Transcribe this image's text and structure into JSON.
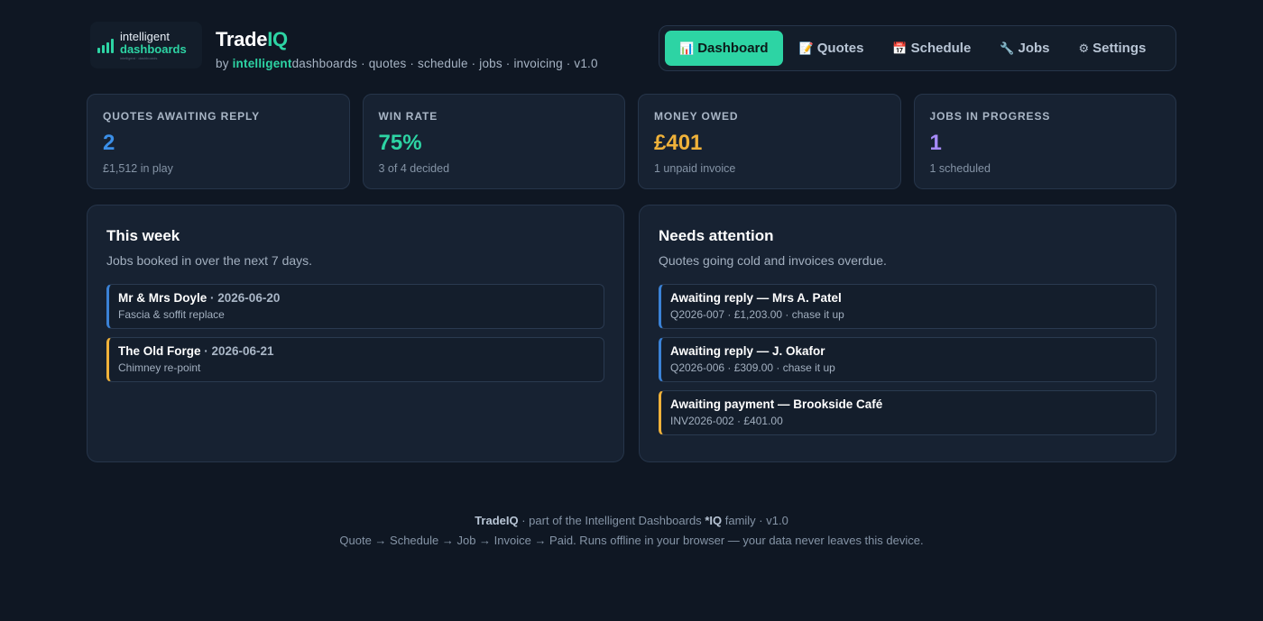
{
  "logo": {
    "line1": "intelligent",
    "line2": "dashboards",
    "tagline": "intelligent · dashboards"
  },
  "brand": {
    "title_main": "Trade",
    "title_accent": "IQ",
    "sub_prefix": "by ",
    "sub_em": "intelligent",
    "sub_rest": "dashboards · quotes · schedule · jobs · invoicing · v1.0"
  },
  "nav": [
    {
      "icon": "📊",
      "label": "Dashboard",
      "active": true
    },
    {
      "icon": "📝",
      "label": "Quotes"
    },
    {
      "icon": "📅",
      "label": "Schedule"
    },
    {
      "icon": "🔧",
      "label": "Jobs"
    },
    {
      "icon": "⚙",
      "label": "Settings"
    }
  ],
  "stats": [
    {
      "label": "QUOTES AWAITING REPLY",
      "value": "2",
      "sub": "£1,512 in play",
      "color": "#3b8fe8"
    },
    {
      "label": "WIN RATE",
      "value": "75%",
      "sub": "3 of 4 decided",
      "color": "#2dd4a4"
    },
    {
      "label": "MONEY OWED",
      "value": "£401",
      "sub": "1 unpaid invoice",
      "color": "#f0b23a"
    },
    {
      "label": "JOBS IN PROGRESS",
      "value": "1",
      "sub": "1 scheduled",
      "color": "#a78bfa"
    }
  ],
  "week": {
    "title": "This week",
    "subtitle": "Jobs booked in over the next 7 days.",
    "items": [
      {
        "name": "Mr & Mrs Doyle",
        "date": " · 2026-06-20",
        "desc": "Fascia & soffit replace"
      },
      {
        "name": "The Old Forge",
        "date": " · 2026-06-21",
        "desc": "Chimney re-point"
      }
    ]
  },
  "attention": {
    "title": "Needs attention",
    "subtitle": "Quotes going cold and invoices overdue.",
    "items": [
      {
        "head": "Awaiting reply — Mrs A. Patel",
        "desc": "Q2026-007 · £1,203.00 · chase it up"
      },
      {
        "head": "Awaiting reply — J. Okafor",
        "desc": "Q2026-006 · £309.00 · chase it up"
      },
      {
        "head": "Awaiting payment — Brookside Café",
        "desc": "INV2026-002 · £401.00"
      }
    ]
  },
  "footer": {
    "brand": "TradeIQ",
    "line1_mid": " · part of the Intelligent Dashboards ",
    "family": "*IQ",
    "line1_end": " family · v1.0",
    "line2": "Quote → Schedule → Job → Invoice → Paid. Runs offline in your browser — your data never leaves this device."
  },
  "colors": {
    "accent": "#2dd4a4",
    "blue": "#3b8fe8",
    "amber": "#f0b23a",
    "purple": "#a78bfa"
  }
}
